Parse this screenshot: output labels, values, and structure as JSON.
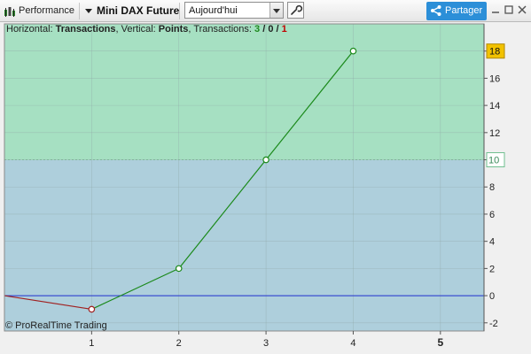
{
  "toolbar": {
    "report_label": "Performance",
    "instrument": "Mini DAX Future",
    "period": "Aujourd'hui",
    "share_label": "Partager"
  },
  "legend": {
    "horizontal_label": "Horizontal: ",
    "horizontal_value": "Transactions",
    "vertical_label": ", Vertical: ",
    "vertical_value": "Points",
    "count_label": ", Transactions: ",
    "winning": "3",
    "slash1": " / ",
    "neutral": "0",
    "slash2": " / ",
    "losing": "1"
  },
  "copyright": "© ProRealTime Trading",
  "colors": {
    "gain_zone": "#a6e0c2",
    "loss_zone": "#aecfdc",
    "gain_line": "#1b8a1b",
    "loss_line": "#a02020",
    "zero_line": "#2030d0",
    "last_value_badge": "#f2c200"
  },
  "chart_data": {
    "type": "line",
    "x": [
      0,
      1,
      2,
      3,
      4
    ],
    "y": [
      0,
      -1,
      2,
      10,
      18
    ],
    "xlim": [
      0,
      5.5
    ],
    "ylim": [
      -2.6,
      20
    ],
    "x_ticks": [
      "1",
      "2",
      "3",
      "4",
      "5"
    ],
    "y_ticks": [
      "-2",
      "0",
      "2",
      "4",
      "6",
      "8",
      "10",
      "12",
      "14",
      "16",
      "18"
    ],
    "zone_threshold": 10,
    "threshold_label": "10",
    "last_value_label": "18",
    "zero_label": "0"
  }
}
